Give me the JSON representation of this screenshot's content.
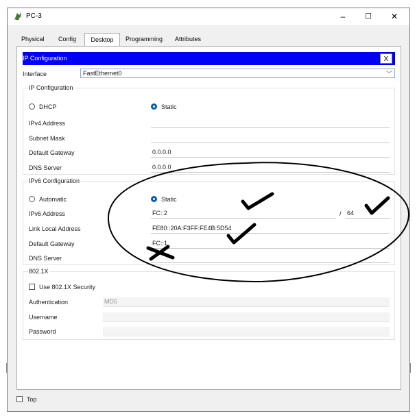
{
  "window": {
    "title": "PC-3",
    "minimize": "–",
    "maximize": "☐",
    "close": "✕"
  },
  "tabs": [
    {
      "label": "Physical"
    },
    {
      "label": "Config"
    },
    {
      "label": "Desktop"
    },
    {
      "label": "Programming"
    },
    {
      "label": "Attributes"
    }
  ],
  "active_tab": "Desktop",
  "ip_config": {
    "title": "IP Configuration",
    "close": "X",
    "interface_label": "Interface",
    "interface_value": "FastEthernet0",
    "ipv4": {
      "group_title": "IP Configuration",
      "dhcp_label": "DHCP",
      "static_label": "Static",
      "mode": "static",
      "fields": [
        {
          "label": "IPv4 Address",
          "value": ""
        },
        {
          "label": "Subnet Mask",
          "value": ""
        },
        {
          "label": "Default Gateway",
          "value": "0.0.0.0"
        },
        {
          "label": "DNS Server",
          "value": "0.0.0.0"
        }
      ]
    },
    "ipv6": {
      "group_title": "IPv6 Configuration",
      "automatic_label": "Automatic",
      "static_label": "Static",
      "mode": "static",
      "address_label": "IPv6 Address",
      "address_value": "FC::2",
      "prefix_sep": "/",
      "prefix_value": "64",
      "link_local_label": "Link Local Address",
      "link_local_value": "FE80::20A:F3FF:FE4B:5D54",
      "gateway_label": "Default Gateway",
      "gateway_value": "FC::1",
      "dns_label": "DNS Server",
      "dns_value": ""
    },
    "dot1x": {
      "group_title": "802.1X",
      "use_label": "Use 802.1X Security",
      "auth_label": "Authentication",
      "auth_value": "MD5",
      "username_label": "Username",
      "password_label": "Password"
    }
  },
  "footer": {
    "top_label": "Top"
  },
  "colors": {
    "ipbar": "#0000f5",
    "accent": "#005fb8",
    "tab_underline": "#1a5fb4"
  }
}
